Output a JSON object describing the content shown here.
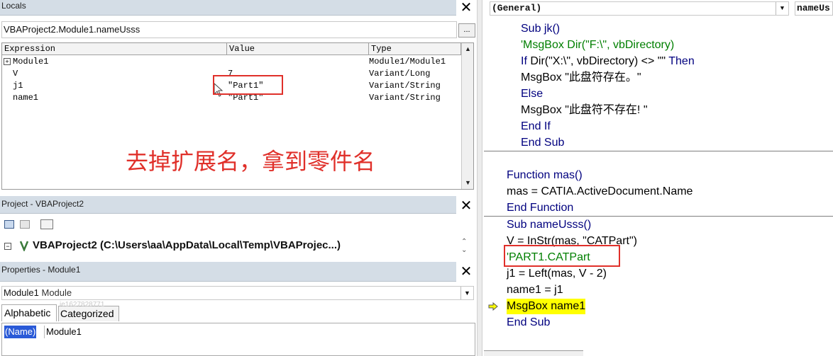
{
  "locals": {
    "title": "Locals",
    "context": "VBAProject2.Module1.nameUsss",
    "context_button": "...",
    "columns": [
      "Expression",
      "Value",
      "Type"
    ],
    "rows": [
      {
        "expr": "Module1",
        "value": "",
        "type": "Module1/Module1"
      },
      {
        "expr": "V",
        "value": "7",
        "type": "Variant/Long"
      },
      {
        "expr": "j1",
        "value": "\"Part1\"",
        "type": "Variant/String"
      },
      {
        "expr": "name1",
        "value": "\"Part1\"",
        "type": "Variant/String"
      }
    ],
    "annotation": "去掉扩展名，拿到零件名"
  },
  "project": {
    "title": "Project - VBAProject2",
    "tree_item": "VBAProject2 (C:\\Users\\aa\\AppData\\Local\\Temp\\VBAProjec...)"
  },
  "properties": {
    "title": "Properties - Module1",
    "object_name": "Module1",
    "object_type": "Module",
    "tabs": [
      "Alphabetic",
      "Categorized"
    ],
    "prop_name": "(Name)",
    "prop_value": "Module1",
    "watermark": "ie1627828771"
  },
  "code": {
    "object_dropdown": "(General)",
    "proc_dropdown": "nameUs",
    "lines_block1": [
      {
        "text": "Sub jk()",
        "kind": "kw"
      },
      {
        "text": "'MsgBox Dir(\"F:\\\", vbDirectory)",
        "kind": "cmt"
      },
      {
        "text": "If Dir(\"X:\\\", vbDirectory) <> \"\" Then",
        "kind": "mixed_if"
      },
      {
        "text": "MsgBox \"此盘符存在。\"",
        "kind": "plain"
      },
      {
        "text": "Else",
        "kind": "kw"
      },
      {
        "text": "MsgBox \"此盘符不存在! \"",
        "kind": "plain"
      },
      {
        "text": "End If",
        "kind": "kw"
      },
      {
        "text": "End Sub",
        "kind": "kw"
      }
    ],
    "lines_block2": [
      {
        "text": "Function mas()",
        "kind": "kw"
      },
      {
        "text": "mas = CATIA.ActiveDocument.Name",
        "kind": "plain"
      },
      {
        "text": "End Function",
        "kind": "kw"
      }
    ],
    "lines_block3": [
      {
        "text": "Sub nameUsss()",
        "kind": "kw"
      },
      {
        "text": "V = InStr(mas, \"CATPart\")",
        "kind": "plain"
      },
      {
        "text": "'PART1.CATPart",
        "kind": "cmt"
      },
      {
        "text": "j1 = Left(mas, V - 2)",
        "kind": "plain"
      },
      {
        "text": "name1 = j1",
        "kind": "plain"
      },
      {
        "text": "MsgBox name1",
        "kind": "highlight"
      },
      {
        "text": "End Sub",
        "kind": "kw"
      }
    ],
    "highlight_color": "#ffff00",
    "comment_color": "#007f00",
    "keyword_color": "#00007f",
    "annotation_color": "#e0302a"
  }
}
